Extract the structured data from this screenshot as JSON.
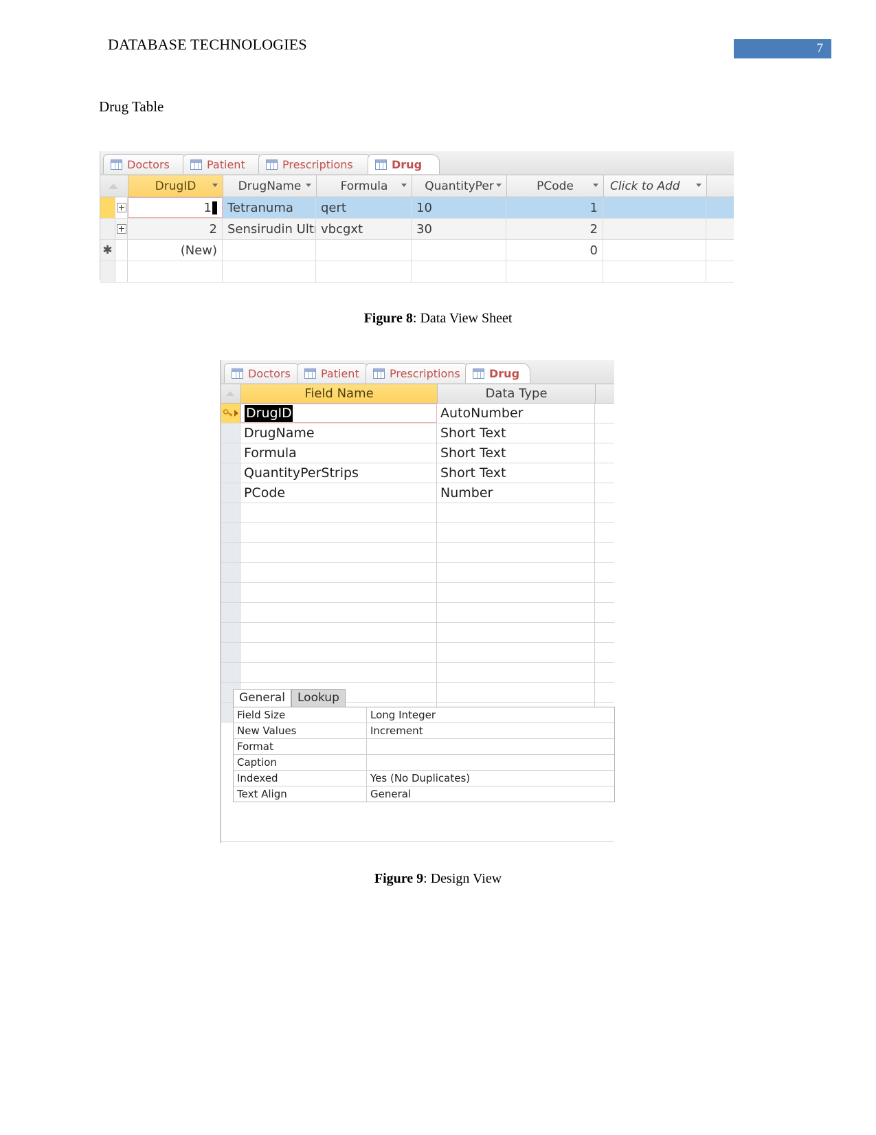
{
  "document": {
    "header_title": "DATABASE TECHNOLOGIES",
    "page_number": "7",
    "header_accent_color": "#4a7ebb",
    "body_text": "Drug Table"
  },
  "figure8": {
    "caption_label": "Figure 8",
    "caption_sep": ": ",
    "caption_text": "Data View Sheet",
    "tabs": [
      {
        "label": "Doctors",
        "icon": "table-icon",
        "active": false
      },
      {
        "label": "Patient",
        "icon": "table-icon",
        "active": false
      },
      {
        "label": "Prescriptions",
        "icon": "table-icon",
        "active": false
      },
      {
        "label": "Drug",
        "icon": "table-icon",
        "active": true
      }
    ],
    "columns": [
      {
        "label": "DrugID",
        "key": true
      },
      {
        "label": "DrugName",
        "key": false
      },
      {
        "label": "Formula",
        "key": false
      },
      {
        "label": "QuantityPer",
        "key": false
      },
      {
        "label": "PCode",
        "key": false
      },
      {
        "label": "Click to Add",
        "key": false
      }
    ],
    "rows": [
      {
        "selected": true,
        "DrugID": "1",
        "DrugName": "Tetranuma",
        "Formula": "qert",
        "QuantityPer": "10",
        "PCode": "1",
        "ClickToAdd": ""
      },
      {
        "selected": false,
        "DrugID": "2",
        "DrugName": "Sensirudin Ultr",
        "Formula": "vbcgxt",
        "QuantityPer": "30",
        "PCode": "2",
        "ClickToAdd": ""
      }
    ],
    "new_row": {
      "DrugID": "(New)",
      "DrugName": "",
      "Formula": "",
      "QuantityPer": "",
      "PCode": "0",
      "ClickToAdd": ""
    },
    "highlight_color": "#b8d8f2",
    "key_column_color": "#fdd26a"
  },
  "figure9": {
    "caption_label": "Figure 9",
    "caption_sep": ": ",
    "caption_text": "Design View",
    "tabs": [
      {
        "label": "Doctors",
        "icon": "table-icon",
        "active": false
      },
      {
        "label": "Patient",
        "icon": "table-icon",
        "active": false
      },
      {
        "label": "Prescriptions",
        "icon": "table-icon",
        "active": false
      },
      {
        "label": "Drug",
        "icon": "table-icon",
        "active": true
      }
    ],
    "headers": {
      "field_name": "Field Name",
      "data_type": "Data Type"
    },
    "fields": [
      {
        "name": "DrugID",
        "type": "AutoNumber",
        "primary_key": true,
        "editing": true
      },
      {
        "name": "DrugName",
        "type": "Short Text",
        "primary_key": false,
        "editing": false
      },
      {
        "name": "Formula",
        "type": "Short Text",
        "primary_key": false,
        "editing": false
      },
      {
        "name": "QuantityPerStrips",
        "type": "Short Text",
        "primary_key": false,
        "editing": false
      },
      {
        "name": "PCode",
        "type": "Number",
        "primary_key": false,
        "editing": false
      }
    ],
    "empty_row_count": 10,
    "property_tabs": [
      {
        "label": "General",
        "active": true
      },
      {
        "label": "Lookup",
        "active": false
      }
    ],
    "properties": [
      {
        "name": "Field Size",
        "value": "Long Integer"
      },
      {
        "name": "New Values",
        "value": "Increment"
      },
      {
        "name": "Format",
        "value": ""
      },
      {
        "name": "Caption",
        "value": ""
      },
      {
        "name": "Indexed",
        "value": "Yes (No Duplicates)"
      },
      {
        "name": "Text Align",
        "value": "General"
      }
    ]
  }
}
